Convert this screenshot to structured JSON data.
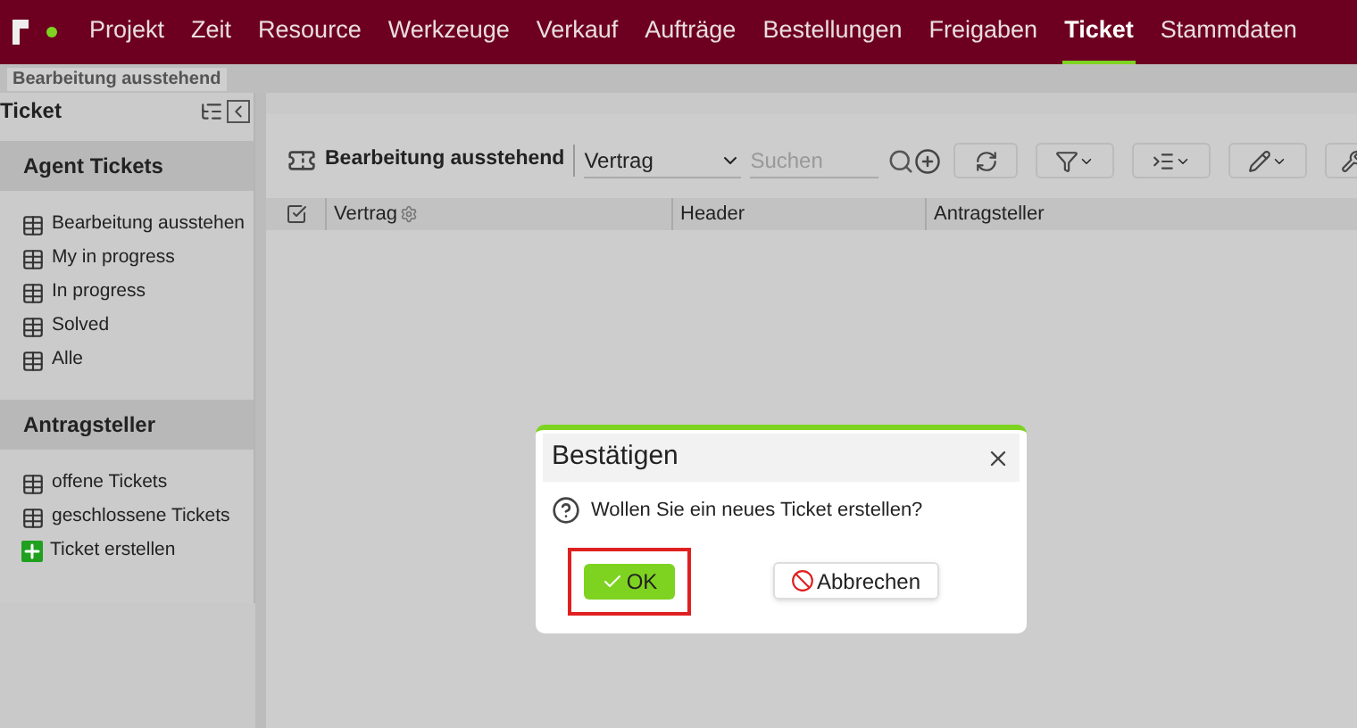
{
  "nav": {
    "items": [
      {
        "label": "Projekt",
        "selected": false
      },
      {
        "label": "Zeit",
        "selected": false
      },
      {
        "label": "Resource",
        "selected": false
      },
      {
        "label": "Werkzeuge",
        "selected": false
      },
      {
        "label": "Verkauf",
        "selected": false
      },
      {
        "label": "Aufträge",
        "selected": false
      },
      {
        "label": "Bestellungen",
        "selected": false
      },
      {
        "label": "Freigaben",
        "selected": false
      },
      {
        "label": "Ticket",
        "selected": true
      },
      {
        "label": "Stammdaten",
        "selected": false
      }
    ]
  },
  "breadcrumb": "Bearbeitung ausstehend",
  "sidebar": {
    "title": "Ticket",
    "sections": [
      {
        "title": "Agent Tickets",
        "items": [
          {
            "label": "Bearbeitung ausstehen",
            "kind": "list"
          },
          {
            "label": "My in progress",
            "kind": "list"
          },
          {
            "label": "In progress",
            "kind": "list"
          },
          {
            "label": "Solved",
            "kind": "list"
          },
          {
            "label": "Alle",
            "kind": "list"
          }
        ]
      },
      {
        "title": "Antragsteller",
        "items": [
          {
            "label": "offene Tickets",
            "kind": "list"
          },
          {
            "label": "geschlossene Tickets",
            "kind": "list"
          },
          {
            "label": "Ticket erstellen",
            "kind": "add"
          }
        ]
      }
    ]
  },
  "toolbar": {
    "title": "Bearbeitung ausstehend",
    "select": "Vertrag",
    "search": {
      "placeholder": "Suchen"
    }
  },
  "table": {
    "select_all": {
      "checked": true
    },
    "columns": [
      "Vertrag",
      "Header",
      "Antragsteller"
    ]
  },
  "dialog": {
    "title": "Bestätigen",
    "message": "Wollen Sie ein neues Ticket erstellen?",
    "ok": "OK",
    "cancel": "Abbrechen"
  }
}
